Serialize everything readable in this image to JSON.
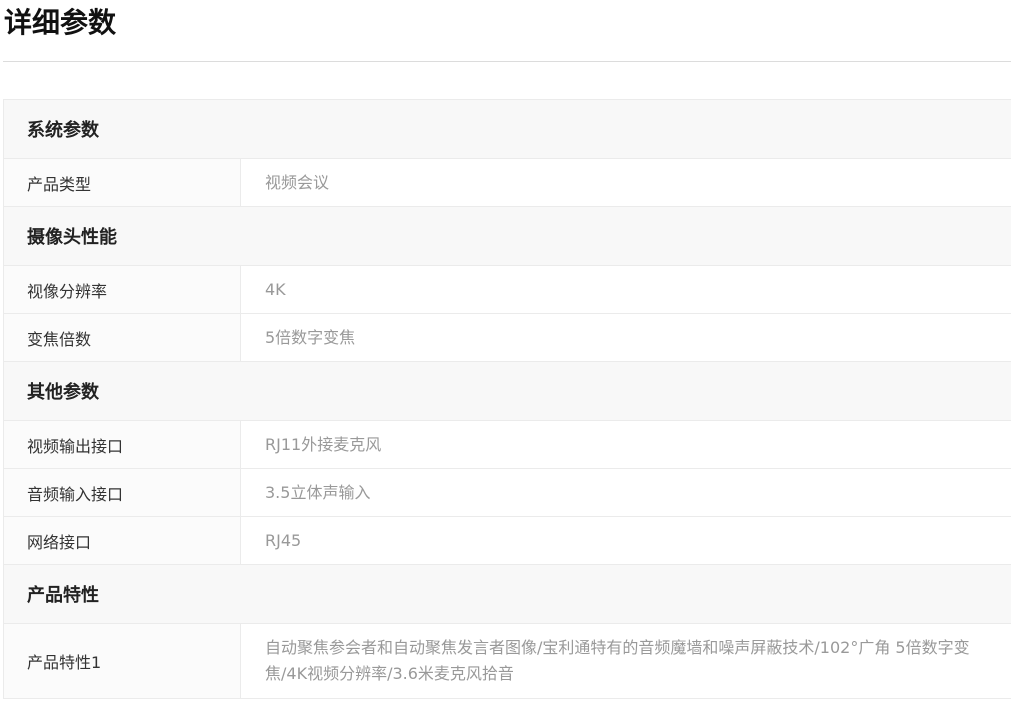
{
  "page": {
    "title": "详细参数"
  },
  "sections": [
    {
      "title": "系统参数",
      "rows": [
        {
          "name": "产品类型",
          "value": "视频会议"
        }
      ]
    },
    {
      "title": "摄像头性能",
      "rows": [
        {
          "name": "视像分辨率",
          "value": "4K"
        },
        {
          "name": "变焦倍数",
          "value": "5倍数字变焦"
        }
      ]
    },
    {
      "title": "其他参数",
      "rows": [
        {
          "name": "视频输出接口",
          "value": "RJ11外接麦克风"
        },
        {
          "name": "音频输入接口",
          "value": "3.5立体声输入"
        },
        {
          "name": "网络接口",
          "value": "RJ45"
        }
      ]
    },
    {
      "title": "产品特性",
      "rows": [
        {
          "name": "产品特性1",
          "value": "自动聚焦参会者和自动聚焦发言者图像/宝利通特有的音频魔墙和噪声屏蔽技术/102°广角 5倍数字变焦/4K视频分辨率/3.6米麦克风拾音"
        }
      ]
    }
  ]
}
